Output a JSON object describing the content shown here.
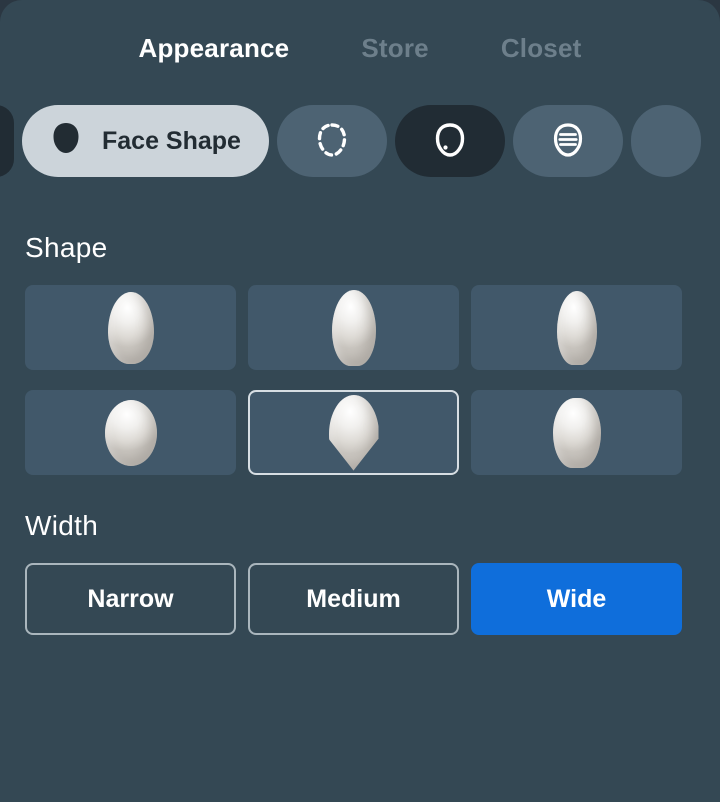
{
  "theme": {
    "panel_bg": "#344854",
    "page_bg": "#2b3742",
    "tile_bg": "#41586a",
    "accent_blue": "#0f6edb",
    "active_pill_bg": "#ccd4da",
    "inactive_tab_text": "#6d7f8b"
  },
  "tabs": [
    {
      "label": "Appearance",
      "active": true
    },
    {
      "label": "Store",
      "active": false
    },
    {
      "label": "Closet",
      "active": false
    }
  ],
  "categories": {
    "items": [
      {
        "label": "",
        "icon": "head-silhouette-icon",
        "state": "partial-left",
        "active": false
      },
      {
        "label": "Face Shape",
        "icon": "head-filled-icon",
        "state": "active",
        "active": true
      },
      {
        "label": "",
        "icon": "dashed-face-outline-icon",
        "state": "normal",
        "active": false
      },
      {
        "label": "",
        "icon": "face-outline-icon",
        "state": "dark",
        "active": false
      },
      {
        "label": "",
        "icon": "hair-face-icon",
        "state": "normal",
        "active": false
      },
      {
        "label": "",
        "icon": "partial-icon",
        "state": "partial-right",
        "active": false
      }
    ]
  },
  "shape_section": {
    "title": "Shape",
    "options": [
      {
        "name": "shape-oval",
        "thumb": "h-oval",
        "selected": false
      },
      {
        "name": "shape-long",
        "thumb": "h-long",
        "selected": false
      },
      {
        "name": "shape-narrow",
        "thumb": "h-narrow",
        "selected": false
      },
      {
        "name": "shape-round",
        "thumb": "h-round",
        "selected": false
      },
      {
        "name": "shape-heart",
        "thumb": "h-heart",
        "selected": true
      },
      {
        "name": "shape-square",
        "thumb": "h-square",
        "selected": false
      }
    ]
  },
  "width_section": {
    "title": "Width",
    "options": [
      {
        "label": "Narrow",
        "selected": false
      },
      {
        "label": "Medium",
        "selected": false
      },
      {
        "label": "Wide",
        "selected": true
      }
    ]
  }
}
